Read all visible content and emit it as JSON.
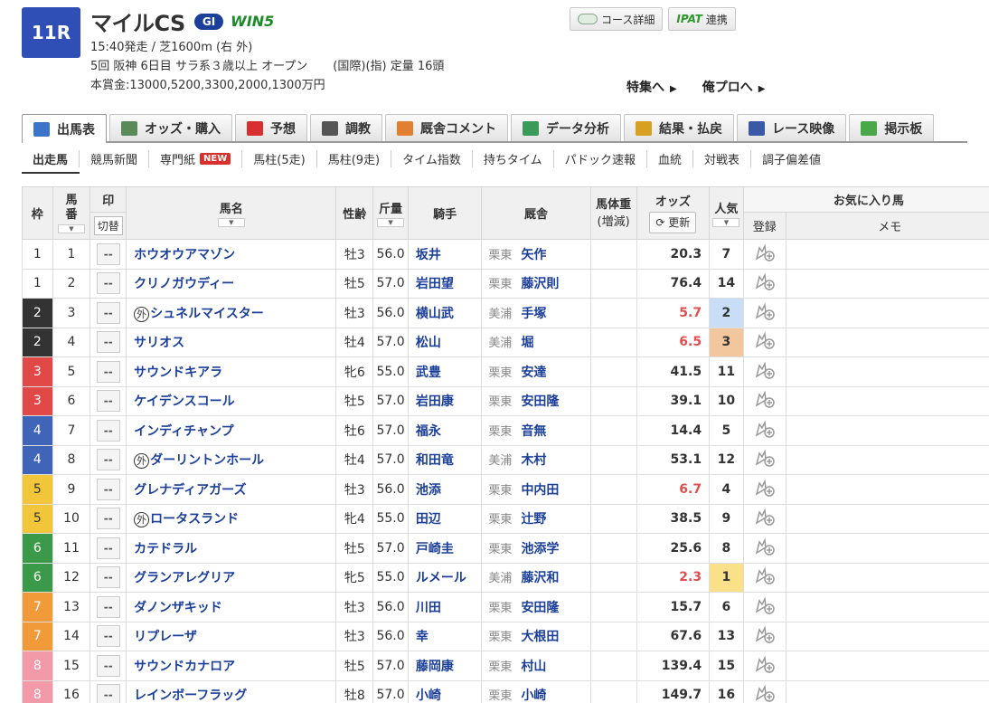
{
  "race": {
    "number": "11R",
    "name": "マイルCS",
    "grade": "GI",
    "win5": "WIN5",
    "line1": "15:40発走 / 芝1600m (右 外)",
    "line2a": "5回 阪神 6日目 サラ系３歳以上 オープン",
    "line2b": "(国際)(指) 定量 16頭",
    "line3": "本賞金:13000,5200,3300,2000,1300万円"
  },
  "top_buttons": {
    "course": "コース詳細",
    "ipat": "IPAT",
    "renkei": "連携"
  },
  "feature_links": [
    "特集へ",
    "俺プロへ"
  ],
  "main_tabs": [
    {
      "label": "出馬表",
      "color": "#3b74c8"
    },
    {
      "label": "オッズ・購入",
      "color": "#5a8a5a"
    },
    {
      "label": "予想",
      "color": "#d83030"
    },
    {
      "label": "調教",
      "color": "#555555"
    },
    {
      "label": "厩舎コメント",
      "color": "#e08030"
    },
    {
      "label": "データ分析",
      "color": "#3a9a5a"
    },
    {
      "label": "結果・払戻",
      "color": "#d8a020"
    },
    {
      "label": "レース映像",
      "color": "#3a5aa8"
    },
    {
      "label": "掲示板",
      "color": "#4aa84a"
    }
  ],
  "sub_tabs": [
    "出走馬",
    "競馬新聞",
    "専門紙",
    "馬柱(5走)",
    "馬柱(9走)",
    "タイム指数",
    "持ちタイム",
    "パドック速報",
    "血統",
    "対戦表",
    "調子偏差値"
  ],
  "new_badge": "NEW",
  "headers": {
    "waku": "枠",
    "umaban_1": "馬",
    "umaban_2": "番",
    "mark": "印",
    "kirikae": "切替",
    "horse": "馬名",
    "sexage": "性齢",
    "kin": "斤量",
    "jockey": "騎手",
    "trainer": "厩舎",
    "weight_1": "馬体重",
    "weight_2": "(増減)",
    "odds": "オッズ",
    "koushin": "更新",
    "pop": "人気",
    "fav": "お気に入り馬",
    "reg": "登録",
    "memo": "メモ"
  },
  "colors": {
    "waku1": "#ffffff",
    "waku2": "#333333",
    "waku3": "#e14848",
    "waku4": "#3f64b8",
    "waku5": "#f1c63a",
    "waku6": "#3a9a4a",
    "waku7": "#f09a3a",
    "waku8": "#f29aa8"
  },
  "entries": [
    {
      "waku": "1",
      "umaban": "1",
      "mark": "--",
      "gai": "",
      "name": "ホウオウアマゾン",
      "sexage": "牡3",
      "kin": "56.0",
      "jockey": "坂井",
      "area": "栗東",
      "trainer": "矢作",
      "odds": "20.3",
      "pop": "7"
    },
    {
      "waku": "1",
      "umaban": "2",
      "mark": "--",
      "gai": "",
      "name": "クリノガウディー",
      "sexage": "牡5",
      "kin": "57.0",
      "jockey": "岩田望",
      "area": "栗東",
      "trainer": "藤沢則",
      "odds": "76.4",
      "pop": "14"
    },
    {
      "waku": "2",
      "umaban": "3",
      "mark": "--",
      "gai": "外",
      "name": "シュネルマイスター",
      "sexage": "牡3",
      "kin": "56.0",
      "jockey": "横山武",
      "area": "美浦",
      "trainer": "手塚",
      "odds": "5.7",
      "pop": "2"
    },
    {
      "waku": "2",
      "umaban": "4",
      "mark": "--",
      "gai": "",
      "name": "サリオス",
      "sexage": "牡4",
      "kin": "57.0",
      "jockey": "松山",
      "area": "美浦",
      "trainer": "堀",
      "odds": "6.5",
      "pop": "3"
    },
    {
      "waku": "3",
      "umaban": "5",
      "mark": "--",
      "gai": "",
      "name": "サウンドキアラ",
      "sexage": "牝6",
      "kin": "55.0",
      "jockey": "武豊",
      "area": "栗東",
      "trainer": "安達",
      "odds": "41.5",
      "pop": "11"
    },
    {
      "waku": "3",
      "umaban": "6",
      "mark": "--",
      "gai": "",
      "name": "ケイデンスコール",
      "sexage": "牡5",
      "kin": "57.0",
      "jockey": "岩田康",
      "area": "栗東",
      "trainer": "安田隆",
      "odds": "39.1",
      "pop": "10"
    },
    {
      "waku": "4",
      "umaban": "7",
      "mark": "--",
      "gai": "",
      "name": "インディチャンプ",
      "sexage": "牡6",
      "kin": "57.0",
      "jockey": "福永",
      "area": "栗東",
      "trainer": "音無",
      "odds": "14.4",
      "pop": "5"
    },
    {
      "waku": "4",
      "umaban": "8",
      "mark": "--",
      "gai": "外",
      "name": "ダーリントンホール",
      "sexage": "牡4",
      "kin": "57.0",
      "jockey": "和田竜",
      "area": "美浦",
      "trainer": "木村",
      "odds": "53.1",
      "pop": "12"
    },
    {
      "waku": "5",
      "umaban": "9",
      "mark": "--",
      "gai": "",
      "name": "グレナディアガーズ",
      "sexage": "牡3",
      "kin": "56.0",
      "jockey": "池添",
      "area": "栗東",
      "trainer": "中内田",
      "odds": "6.7",
      "pop": "4"
    },
    {
      "waku": "5",
      "umaban": "10",
      "mark": "--",
      "gai": "外",
      "name": "ロータスランド",
      "sexage": "牝4",
      "kin": "55.0",
      "jockey": "田辺",
      "area": "栗東",
      "trainer": "辻野",
      "odds": "38.5",
      "pop": "9"
    },
    {
      "waku": "6",
      "umaban": "11",
      "mark": "--",
      "gai": "",
      "name": "カテドラル",
      "sexage": "牡5",
      "kin": "57.0",
      "jockey": "戸崎圭",
      "area": "栗東",
      "trainer": "池添学",
      "odds": "25.6",
      "pop": "8"
    },
    {
      "waku": "6",
      "umaban": "12",
      "mark": "--",
      "gai": "",
      "name": "グランアレグリア",
      "sexage": "牝5",
      "kin": "55.0",
      "jockey": "ルメール",
      "area": "美浦",
      "trainer": "藤沢和",
      "odds": "2.3",
      "pop": "1"
    },
    {
      "waku": "7",
      "umaban": "13",
      "mark": "--",
      "gai": "",
      "name": "ダノンザキッド",
      "sexage": "牡3",
      "kin": "56.0",
      "jockey": "川田",
      "area": "栗東",
      "trainer": "安田隆",
      "odds": "15.7",
      "pop": "6"
    },
    {
      "waku": "7",
      "umaban": "14",
      "mark": "--",
      "gai": "",
      "name": "リプレーザ",
      "sexage": "牡3",
      "kin": "56.0",
      "jockey": "幸",
      "area": "栗東",
      "trainer": "大根田",
      "odds": "67.6",
      "pop": "13"
    },
    {
      "waku": "8",
      "umaban": "15",
      "mark": "--",
      "gai": "",
      "name": "サウンドカナロア",
      "sexage": "牡5",
      "kin": "57.0",
      "jockey": "藤岡康",
      "area": "栗東",
      "trainer": "村山",
      "odds": "139.4",
      "pop": "15"
    },
    {
      "waku": "8",
      "umaban": "16",
      "mark": "--",
      "gai": "",
      "name": "レインボーフラッグ",
      "sexage": "牡8",
      "kin": "57.0",
      "jockey": "小崎",
      "area": "栗東",
      "trainer": "小崎",
      "odds": "149.7",
      "pop": "16"
    }
  ]
}
